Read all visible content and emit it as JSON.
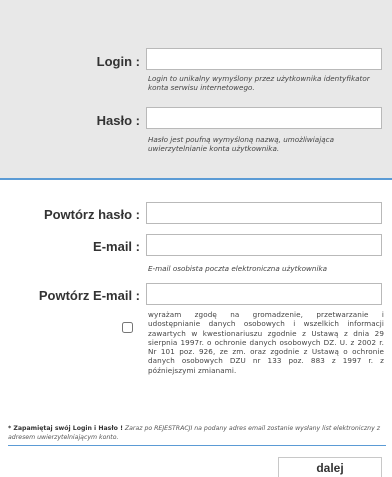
{
  "form": {
    "login": {
      "label": "Login :",
      "value": "",
      "hint": "Login to unikalny wymyślony przez użytkownika identyfikator konta serwisu internetowego."
    },
    "password": {
      "label": "Hasło :",
      "value": "",
      "hint": "Hasło jest poufną wymyśloną nazwą, umożliwiająca uwierzytelnianie konta użytkownika."
    },
    "repeat_password": {
      "label": "Powtórz hasło :",
      "value": ""
    },
    "email": {
      "label": "E-mail :",
      "value": "",
      "hint": "E-mail osobista poczta elektroniczna użytkownika"
    },
    "repeat_email": {
      "label": "Powtórz E-mail :",
      "value": ""
    },
    "consent": {
      "checked": false,
      "text": "wyrażam zgodę na gromadzenie, przetwarzanie i udostępnianie danych osobowych i wszelkich informacji zawartych w kwestionariuszu zgodnie z Ustawą z dnia 29 sierpnia 1997r. o ochronie danych osobowych DZ. U. z 2002 r. Nr 101 poz. 926, ze zm. oraz zgodnie z Ustawą o ochronie danych osobowych DZU nr 133 poz. 883 z 1997 r. z późniejszymi zmianami."
    }
  },
  "footer": {
    "note_bold": "* Zapamiętaj swój Login i Hasło !",
    "note_italic": "Zaraz po REJESTRACJI na podany adres email zostanie wysłany list elektroniczny z adresem uwierzytelniającym konto."
  },
  "buttons": {
    "next_label": "dalej"
  },
  "colors": {
    "top_panel_bg": "#e8e8e8",
    "accent": "#5b9bd5"
  }
}
